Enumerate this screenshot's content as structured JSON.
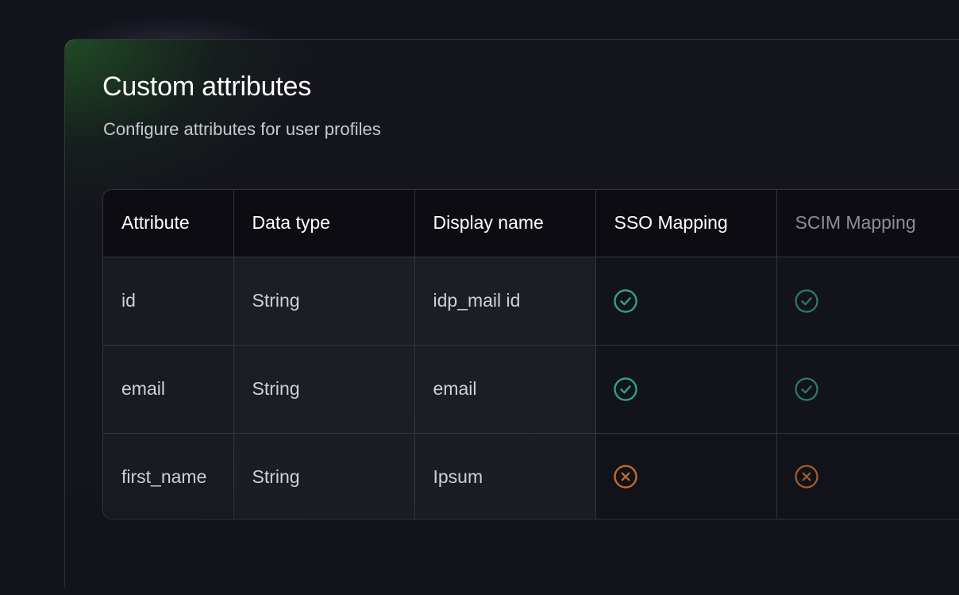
{
  "header": {
    "title": "Custom attributes",
    "subtitle": "Configure attributes for user profiles"
  },
  "table": {
    "columns": [
      "Attribute",
      "Data type",
      "Display name",
      "SSO Mapping",
      "SCIM Mapping"
    ],
    "rows": [
      {
        "attribute": "id",
        "data_type": "String",
        "display_name": "idp_mail id",
        "sso_mapping": "check-icon",
        "scim_mapping": "check-icon"
      },
      {
        "attribute": "email",
        "data_type": "String",
        "display_name": "email",
        "sso_mapping": "check-icon",
        "scim_mapping": "check-icon"
      },
      {
        "attribute": "first_name",
        "data_type": "String",
        "display_name": "Ipsum",
        "sso_mapping": "x-icon",
        "scim_mapping": "x-icon"
      }
    ]
  },
  "colors": {
    "check": "#2fa57d",
    "check_muted": "#2a7f66",
    "cross": "#c2692a",
    "cross_muted": "#a95d28"
  }
}
